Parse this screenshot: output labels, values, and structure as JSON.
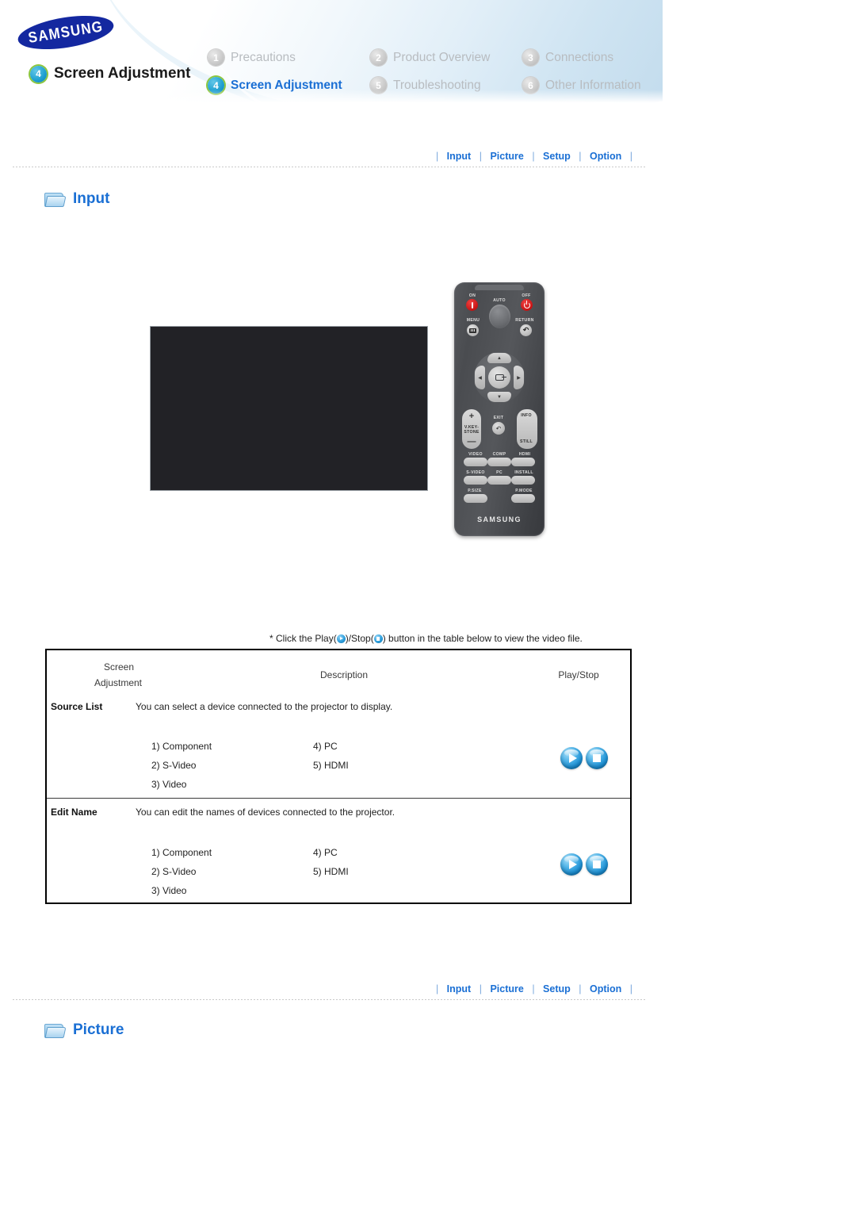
{
  "brand": {
    "logo_text": "SAMSUNG"
  },
  "header": {
    "badge_number": "4",
    "page_title": "Screen Adjustment",
    "nav": [
      {
        "number": "1",
        "label": "Precautions",
        "active": false
      },
      {
        "number": "2",
        "label": "Product Overview",
        "active": false
      },
      {
        "number": "3",
        "label": "Connections",
        "active": false
      },
      {
        "number": "4",
        "label": "Screen Adjustment",
        "active": true
      },
      {
        "number": "5",
        "label": "Troubleshooting",
        "active": false
      },
      {
        "number": "6",
        "label": "Other Information",
        "active": false
      }
    ]
  },
  "linkbar": {
    "items": [
      "Input",
      "Picture",
      "Setup",
      "Option"
    ],
    "separator": "|"
  },
  "sections": [
    {
      "id": "input",
      "title": "Input"
    },
    {
      "id": "picture",
      "title": "Picture"
    }
  ],
  "note": {
    "prefix": "* Click the Play(",
    "middle": ")/Stop(",
    "suffix": ") button in the table below to view the video file."
  },
  "table": {
    "headers": {
      "col1_line1": "Screen",
      "col1_line2": "Adjustment",
      "col2": "Description",
      "col3": "Play/Stop"
    },
    "rows": [
      {
        "label": "Source List",
        "description": "You can select a device connected to the projector to display.",
        "options_left": [
          "1) Component",
          "2) S-Video",
          "3) Video"
        ],
        "options_right": [
          "4) PC",
          "5) HDMI"
        ],
        "play_label": "play-button",
        "stop_label": "stop-button"
      },
      {
        "label": "Edit Name",
        "description": "You can edit the names of devices connected to the projector.",
        "options_left": [
          "1) Component",
          "2) S-Video",
          "3) Video"
        ],
        "options_right": [
          "4) PC",
          "5) HDMI"
        ],
        "play_label": "play-button",
        "stop_label": "stop-button"
      }
    ]
  },
  "remote": {
    "brand": "SAMSUNG",
    "labels": {
      "on": "ON",
      "off": "OFF",
      "auto": "AUTO",
      "menu": "MENU",
      "return": "RETURN",
      "vkeystone_line1": "V.KEY-",
      "vkeystone_line2": "STONE",
      "plus": "+",
      "minus": "—",
      "exit": "EXIT",
      "info": "INFO",
      "still": "STILL",
      "video": "VIDEO",
      "comp": "COMP",
      "hdmi": "HDMI",
      "svideo": "S-VIDEO",
      "pc": "PC",
      "install": "INSTALL",
      "psize": "P.SIZE",
      "pmode": "P.MODE"
    }
  },
  "colors": {
    "link_blue": "#1a6fd4",
    "active_badge": "#1e9fd0",
    "badge_ring_green": "#8dc63f",
    "samsung_blue": "#1428a0",
    "video_bg": "#222226",
    "button_blue": "#1b8fd4"
  }
}
